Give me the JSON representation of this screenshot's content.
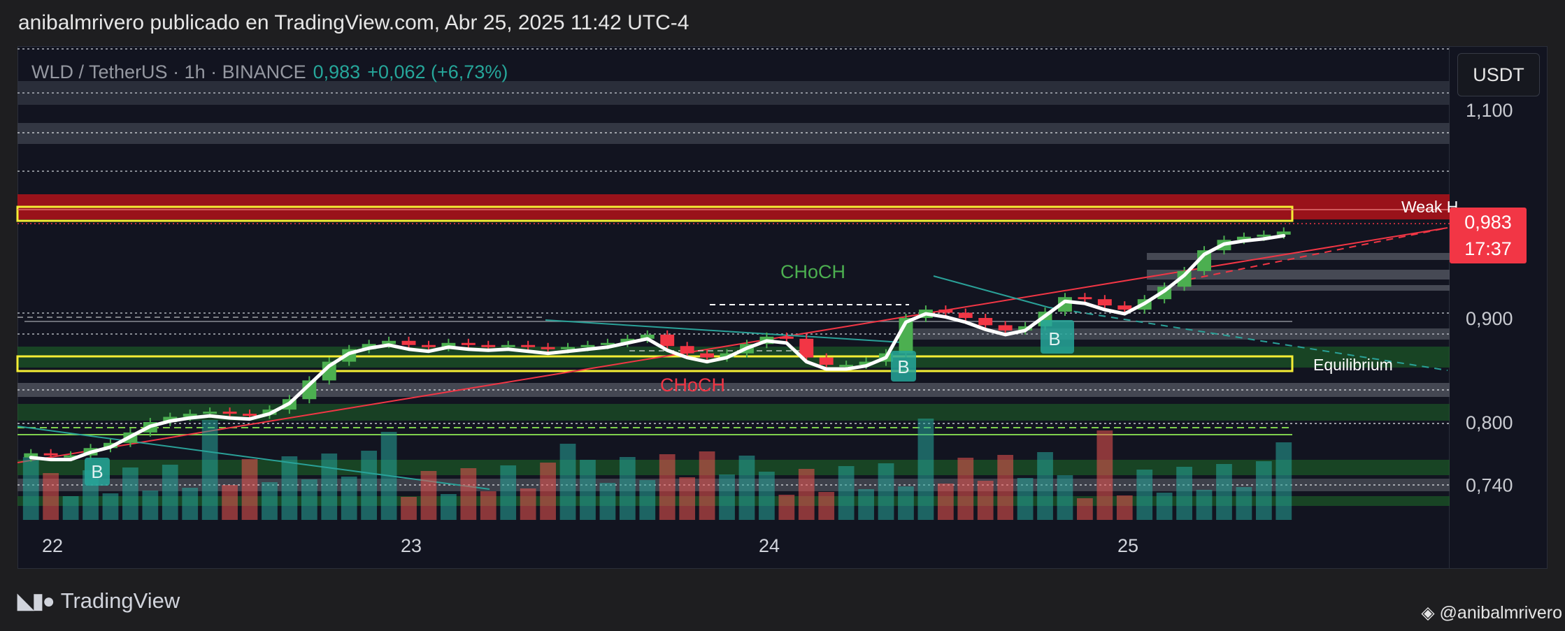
{
  "header": {
    "publisher_line": "anibalmrivero publicado en TradingView.com, Abr 25, 2025 11:42 UTC-4"
  },
  "symbol": {
    "name": "WLD / TetherUS · 1h · BINANCE",
    "last_price": "0,983",
    "change": "+0,062 (+6,73%)"
  },
  "currency_button": "USDT",
  "price_tag": {
    "price": "0,983",
    "countdown": "17:37"
  },
  "annotations": {
    "choch_green": "CHoCH",
    "choch_red": "CHoCH",
    "weak_high": "Weak H",
    "equilibrium": "Equilibrium",
    "buy_marker": "B"
  },
  "footer": {
    "brand": "TradingView",
    "watermark": "@anibalmrivero"
  },
  "colors": {
    "background": "#121420",
    "up": "#4caf50",
    "down": "#f23645",
    "vol_up": "#26a69a",
    "vol_down": "#ef5350",
    "ma_line": "#ffffff",
    "premium_zone": "#b2121a",
    "yellow_box": "#f5ee35"
  },
  "chart_data": {
    "type": "candlestick",
    "title": "WLD / TetherUS · 1h · BINANCE",
    "x_tick_labels": [
      "22",
      "23",
      "24",
      "25"
    ],
    "y_tick_labels": [
      "1,100",
      "1,000",
      "0,900",
      "0,800",
      "0,740"
    ],
    "y_ticks": [
      1.1,
      1.0,
      0.9,
      0.8,
      0.74
    ],
    "last_price": 0.983,
    "levels": {
      "weak_high": 0.995,
      "equilibrium": 0.845,
      "premium_zone": [
        0.98,
        1.01
      ]
    },
    "close_series_approx": [
      0.77,
      0.768,
      0.768,
      0.775,
      0.78,
      0.79,
      0.8,
      0.805,
      0.808,
      0.81,
      0.808,
      0.807,
      0.812,
      0.822,
      0.84,
      0.858,
      0.87,
      0.875,
      0.878,
      0.874,
      0.872,
      0.876,
      0.874,
      0.873,
      0.874,
      0.872,
      0.87,
      0.872,
      0.874,
      0.876,
      0.88,
      0.884,
      0.873,
      0.866,
      0.862,
      0.866,
      0.875,
      0.882,
      0.88,
      0.862,
      0.855,
      0.855,
      0.858,
      0.866,
      0.9,
      0.908,
      0.905,
      0.9,
      0.893,
      0.888,
      0.892,
      0.906,
      0.92,
      0.918,
      0.912,
      0.908,
      0.918,
      0.93,
      0.945,
      0.965,
      0.975,
      0.978,
      0.98,
      0.983
    ]
  }
}
